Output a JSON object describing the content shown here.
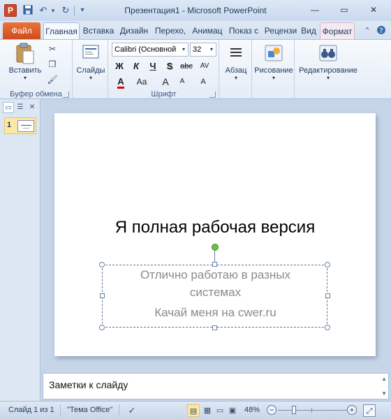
{
  "window": {
    "title": "Презентация1  -  Microsoft PowerPoint",
    "app_letter": "P",
    "qat": {
      "save_icon": "floppy-disk-icon",
      "undo_glyph": "↶",
      "redo_glyph": "↻",
      "customize_glyph": "▾"
    },
    "controls": {
      "minimize": "—",
      "maximize": "▭",
      "close": "✕"
    }
  },
  "tabs": [
    {
      "label": "Файл"
    },
    {
      "label": "Главная"
    },
    {
      "label": "Вставка"
    },
    {
      "label": "Дизайн"
    },
    {
      "label": "Перехо,"
    },
    {
      "label": "Анимац"
    },
    {
      "label": "Показ с"
    },
    {
      "label": "Рецензи"
    },
    {
      "label": "Вид"
    },
    {
      "label": "Формат"
    }
  ],
  "ribbon": {
    "clipboard": {
      "label": "Буфер обмена",
      "paste_label": "Вставить"
    },
    "slides": {
      "label": "Слайды"
    },
    "font": {
      "label": "Шрифт",
      "font_name": "Calibri (Основной",
      "font_size": "32",
      "bold": "Ж",
      "italic": "К",
      "underline": "Ч",
      "shadow": "S",
      "strike": "abc",
      "spacing": "AV",
      "case": "Aa",
      "grow": "A",
      "shrink": "A",
      "clear": "A"
    },
    "paragraph": {
      "label": "Абзац"
    },
    "drawing": {
      "label": "Рисование"
    },
    "editing": {
      "label": "Редактирование"
    }
  },
  "left_panel": {
    "slide_number": "1",
    "close_glyph": "✕"
  },
  "slide": {
    "title": "Я полная рабочая версия",
    "subtitle_line1": "Отлично работаю в разных",
    "subtitle_line2": "системах",
    "subtitle_line3": "Качай меня на cwer.ru"
  },
  "notes": {
    "placeholder": "Заметки к слайду"
  },
  "status": {
    "slide_info": "Слайд 1 из 1",
    "theme": "\"Тема Office\"",
    "zoom": "48%",
    "minus": "−",
    "plus": "+"
  },
  "colors": {
    "file_tab": "#d14a1d",
    "accent": "#1e395b",
    "selection": "#fde8a6",
    "rotate_handle": "#6cc04a"
  }
}
